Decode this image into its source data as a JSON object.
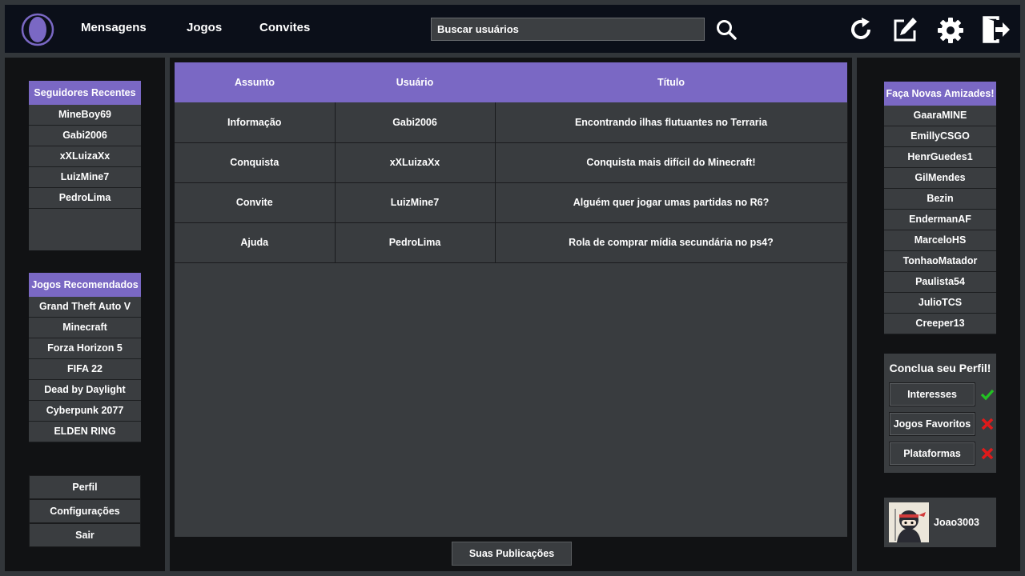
{
  "nav": {
    "messages": "Mensagens",
    "games": "Jogos",
    "invites": "Convites"
  },
  "search": {
    "placeholder": "Buscar usuários"
  },
  "icons": {
    "logo": "logo-icon",
    "search": "search-icon",
    "refresh": "refresh-icon",
    "edit": "edit-icon",
    "settings": "gear-icon",
    "logout": "logout-icon"
  },
  "colors": {
    "accent": "#7a68c4",
    "topbar": "#0b0f19",
    "panel": "#111214",
    "item": "#3a3d40",
    "check": "#22c322",
    "cross": "#e01a1a"
  },
  "recent_followers": {
    "title": "Seguidores Recentes",
    "items": [
      "MineBoy69",
      "Gabi2006",
      "xXLuizaXx",
      "LuizMine7",
      "PedroLima"
    ]
  },
  "recommended_games": {
    "title": "Jogos Recomendados",
    "items": [
      "Grand Theft Auto V",
      "Minecraft",
      "Forza Horizon 5",
      "FIFA 22",
      "Dead by Daylight",
      "Cyberpunk 2077",
      "ELDEN RING"
    ]
  },
  "left_menu": {
    "profile": "Perfil",
    "settings": "Configurações",
    "logout": "Sair"
  },
  "posts": {
    "headers": [
      "Assunto",
      "Usuário",
      "Título"
    ],
    "rows": [
      [
        "Informação",
        "Gabi2006",
        "Encontrando ilhas flutuantes no Terraria"
      ],
      [
        "Conquista",
        "xXLuizaXx",
        "Conquista mais difícil do Minecraft!"
      ],
      [
        "Convite",
        "LuizMine7",
        "Alguém quer jogar umas partidas no R6?"
      ],
      [
        "Ajuda",
        "PedroLima",
        "Rola de comprar mídia secundária no ps4?"
      ]
    ],
    "my_posts_button": "Suas Publicações"
  },
  "new_friends": {
    "title": "Faça Novas Amizades!",
    "items": [
      "GaaraMINE",
      "EmillyCSGO",
      "HenrGuedes1",
      "GilMendes",
      "Bezin",
      "EndermanAF",
      "MarceloHS",
      "TonhaoMatador",
      "Paulista54",
      "JulioTCS",
      "Creeper13"
    ]
  },
  "profile_completion": {
    "title": "Conclua seu Perfil!",
    "items": [
      {
        "label": "Interesses",
        "done": true
      },
      {
        "label": "Jogos Favoritos",
        "done": false
      },
      {
        "label": "Plataformas",
        "done": false
      }
    ]
  },
  "current_user": {
    "name": "Joao3003"
  }
}
